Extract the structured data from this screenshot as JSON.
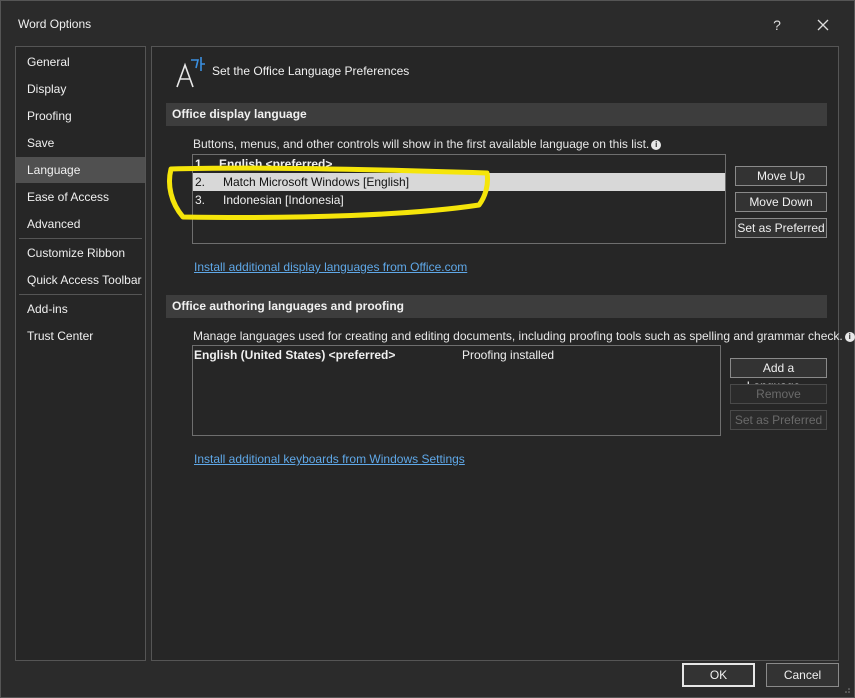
{
  "window": {
    "title": "Word Options",
    "help_label": "?",
    "close_label": "✕"
  },
  "sidebar": {
    "items": [
      {
        "label": "General"
      },
      {
        "label": "Display"
      },
      {
        "label": "Proofing"
      },
      {
        "label": "Save"
      },
      {
        "label": "Language"
      },
      {
        "label": "Ease of Access"
      },
      {
        "label": "Advanced"
      },
      {
        "label": "Customize Ribbon"
      },
      {
        "label": "Quick Access Toolbar"
      },
      {
        "label": "Add-ins"
      },
      {
        "label": "Trust Center"
      }
    ],
    "selected": "Language"
  },
  "header": {
    "title": "Set the Office Language Preferences",
    "icon": "language-icon"
  },
  "display_language": {
    "section_title": "Office display language",
    "description": "Buttons, menus, and other controls will show in the first available language on this list.",
    "items": [
      {
        "num": "1.",
        "label": "English <preferred>"
      },
      {
        "num": "2.",
        "label": "Match Microsoft Windows [English]"
      },
      {
        "num": "3.",
        "label": "Indonesian [Indonesia]"
      }
    ],
    "selected_index": 1,
    "buttons": {
      "move_up": "Move Up",
      "move_down": "Move Down",
      "set_preferred": "Set as Preferred"
    },
    "link": "Install additional display languages from Office.com"
  },
  "authoring_language": {
    "section_title": "Office authoring languages and proofing",
    "description": "Manage languages used for creating and editing documents, including proofing tools such as spelling and grammar check.",
    "items": [
      {
        "label": "English (United States) <preferred>",
        "status": "Proofing installed"
      }
    ],
    "buttons": {
      "add": "Add a Language...",
      "remove": "Remove",
      "set_preferred": "Set as Preferred"
    },
    "link": "Install additional keyboards from Windows Settings"
  },
  "footer": {
    "ok": "OK",
    "cancel": "Cancel"
  },
  "colors": {
    "annotation": "#f5e50a",
    "link": "#5fa8e8",
    "selection": "#d8d8d8"
  }
}
